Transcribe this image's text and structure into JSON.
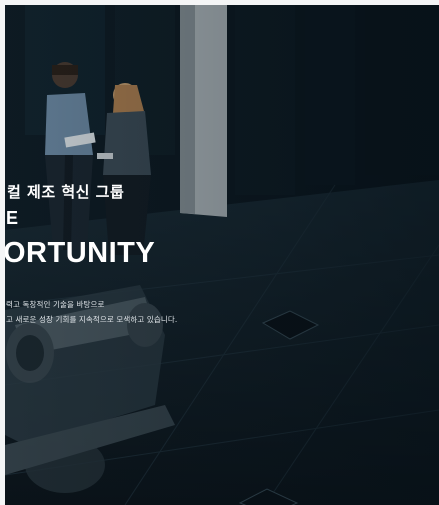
{
  "hero": {
    "subtitle": "컬 제조 혁신 그룹",
    "line_e": "E",
    "headline": "ORTUNITY",
    "description_line1": "력고 독창적인 기술을 바탕으로",
    "description_line2": "고 새로운 성장 기회를 지속적으로 모색하고 있습니다."
  },
  "colors": {
    "background": "#0d1a22",
    "text": "#ffffff"
  }
}
